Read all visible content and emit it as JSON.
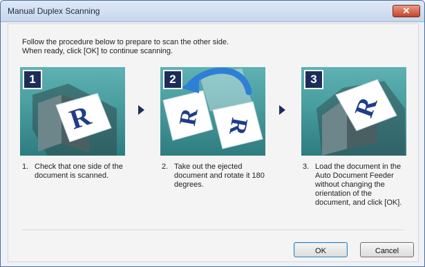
{
  "window": {
    "title": "Manual Duplex Scanning",
    "close_glyph": "✕"
  },
  "intro": {
    "line1": "Follow the procedure below to prepare to scan the other side.",
    "line2": "When ready, click [OK] to continue scanning."
  },
  "steps": [
    {
      "badge": "1",
      "number": "1.",
      "text": "Check that one side of the document is scanned.",
      "illustration_letter": "R",
      "illustration": "scanner-with-document"
    },
    {
      "badge": "2",
      "number": "2.",
      "text": "Take out the ejected document and rotate it 180 degrees.",
      "illustration_letter": "R",
      "illustration": "rotate-document-arrow"
    },
    {
      "badge": "3",
      "number": "3.",
      "text": "Load the document in the Auto Document Feeder without changing the orientation of the document, and click [OK].",
      "illustration_letter": "R",
      "illustration": "load-document-feeder"
    }
  ],
  "buttons": {
    "ok": "OK",
    "cancel": "Cancel"
  },
  "colors": {
    "step_background": "#4a9fa1",
    "badge": "#1d2d5a",
    "rotate_arrow": "#2f7fd6"
  }
}
